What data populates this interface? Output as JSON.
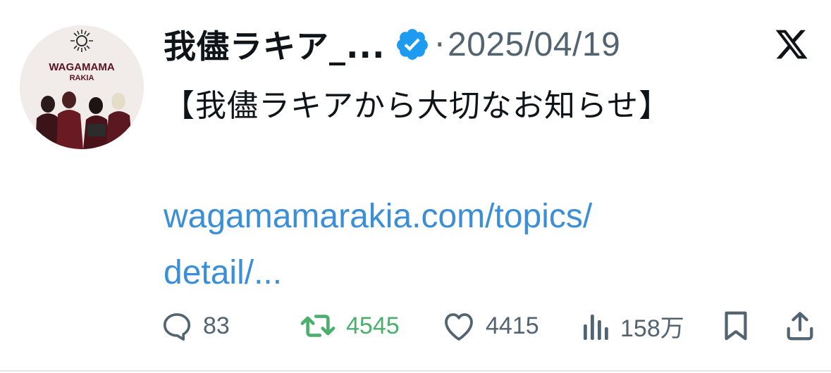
{
  "author": {
    "display_name": "我儘ラキア_...",
    "avatar_logo_text": [
      "WAGAMAMA",
      "RAKIA"
    ]
  },
  "meta": {
    "separator": "·",
    "date": "2025/04/19"
  },
  "tweet": {
    "text": "【我儘ラキアから大切なお知らせ】",
    "link": "wagamamarakia.com/topics/\ndetail/..."
  },
  "actions": {
    "reply_count": "83",
    "retweet_count": "4545",
    "like_count": "4415",
    "views_count": "158万"
  },
  "colors": {
    "link": "#3b8fd9",
    "verified": "#1d9bf0",
    "retweet": "#4caf6e",
    "muted": "#536471",
    "text": "#0f1419"
  },
  "icons": {
    "brand": "x-logo-icon",
    "verified": "verified-badge-icon",
    "reply": "reply-icon",
    "retweet": "retweet-icon",
    "like": "heart-icon",
    "views": "views-icon",
    "bookmark": "bookmark-icon",
    "share": "share-icon"
  }
}
